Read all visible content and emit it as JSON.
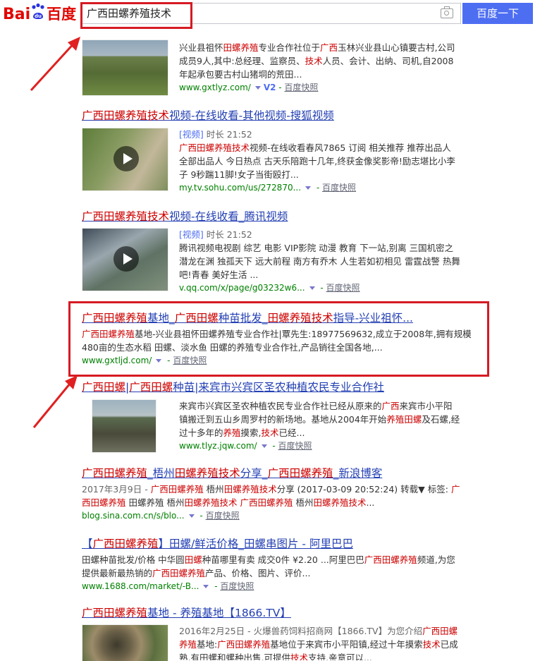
{
  "header": {
    "logo_latin": "Bai",
    "logo_zh": "百度",
    "query": "广西田螺养殖技术",
    "search_button": "百度一下"
  },
  "results": [
    {
      "abs": [
        "兴业县祖怀",
        "田螺养殖",
        "专业合作社位于",
        "广西",
        "玉林兴业县山心镇要古村,公司成员9人,其中:总经理、监察员、",
        "技术",
        "人员、会计、出纳、司机,自2008年起承包要古村山猪垌的荒田..."
      ],
      "url": "www.gxtlyz.com/",
      "badge": "V2",
      "snap": "百度快照"
    },
    {
      "title": [
        "广西田螺养殖技术",
        "视频-在线收看-其他视频-搜狐视频"
      ],
      "tag": "[视频]",
      "duration": "时长 21:52",
      "abs": [
        "广西田螺养殖技术",
        "视频-在线收看春风7865 订阅 相关推荐 推荐出品人 全部出品人 今日热点 古天乐陪跑十几年,终获金像奖影帝!励志堪比小李子 9秒踹11脚!女子当街殴打..."
      ],
      "url": "my.tv.sohu.com/us/272870...",
      "snap": "百度快照"
    },
    {
      "title": [
        "广西田螺养殖技术",
        "视频-在线收看_腾讯视频"
      ],
      "tag": "[视频]",
      "duration": "时长 21:52",
      "abs": [
        "腾讯视频电视剧 综艺 电影 VIP影院 动漫 教育 下一站,别离 三国机密之潜龙在渊 独孤天下 远大前程 南方有乔木 人生若如初相见 雷霆战警 热舞吧!青春 美好生活 ..."
      ],
      "url": "v.qq.com/x/page/g03232w6...",
      "snap": "百度快照"
    },
    {
      "title": [
        "广西田螺养殖",
        "基地_",
        "广西田螺",
        "种苗批发_",
        "田螺养殖技术",
        "指导-兴业祖怀..."
      ],
      "abs": [
        "广西田螺养殖",
        "基地-兴业县祖怀田螺养殖专业合作社|覃先生:18977569632,成立于2008年,拥有规模 480亩的生态水稻 田螺、淡水鱼 田螺的养殖专业合作社,产品销往全国各地,..."
      ],
      "url": "www.gxtljd.com/",
      "snap": "百度快照"
    },
    {
      "title": [
        "广西田螺",
        "|",
        "广西田螺",
        "种苗|来宾市兴宾区圣农种植农民专业合作社"
      ],
      "abs": [
        "来宾市兴宾区圣农种植农民专业合作社已经从原来的",
        "广西",
        "来宾市小平阳镇搬迁到五山乡周罗村的新场地。基地从2004年开始",
        "养殖田螺",
        "及石螺,经过十多年的",
        "养殖",
        "摸索,",
        "技术",
        "已经..."
      ],
      "url": "www.tlyz.jqw.com/",
      "snap": "百度快照"
    },
    {
      "title": [
        "广西田螺养殖",
        "_梧州",
        "田螺养殖技术",
        "分享_",
        "广西田螺养殖",
        "_新浪博客"
      ],
      "abs": [
        "2017年3月9日 - ",
        "广西田螺养殖",
        " 梧州",
        "田螺养殖技术",
        "分享 (2017-03-09 20:52:24) 转载▼ 标签: ",
        "广西田螺养殖",
        " 田螺养殖 梧州",
        "田螺养殖技术",
        " ",
        "广西田螺养殖",
        " 梧州",
        "田螺养殖技术",
        "..."
      ],
      "url": "blog.sina.com.cn/s/blo...",
      "snap": "百度快照"
    },
    {
      "title": [
        "【",
        "广西田螺养殖",
        "】田螺/鲜活价格_田螺串图片 - 阿里巴巴"
      ],
      "abs": [
        "田螺种苗批发/价格 中华圆",
        "田螺",
        "种苗哪里有卖 成交0件 ¥2.20 ...阿里巴巴",
        "广西田螺养殖",
        "频道,为您提供最新最热销的",
        "广西田螺养殖",
        "产品、价格、图片、评价..."
      ],
      "url": "www.1688.com/market/-B...",
      "snap": "百度快照"
    },
    {
      "title": [
        "广西田螺养殖",
        "基地 - 养殖基地【1866.TV】"
      ],
      "abs": [
        "2016年2月25日 - 火爆兽药饲料招商网【1866.TV】为您介绍",
        "广西田螺养殖",
        "基地:",
        "广西田螺养殖",
        "基地位于来宾市小平阳镇,经过十年摸索",
        "技术",
        "已成熟,有田螺和螺种出售,可提供",
        "技术",
        "支持,亲意可以..."
      ]
    }
  ]
}
